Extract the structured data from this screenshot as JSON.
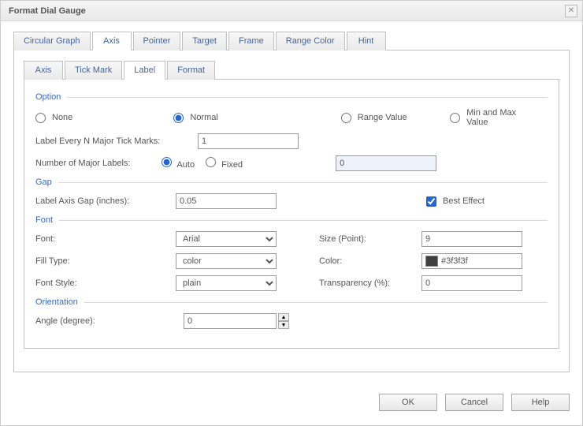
{
  "dialog": {
    "title": "Format Dial Gauge"
  },
  "outerTabs": [
    "Circular Graph",
    "Axis",
    "Pointer",
    "Target",
    "Frame",
    "Range Color",
    "Hint"
  ],
  "outerActive": 1,
  "innerTabs": [
    "Axis",
    "Tick Mark",
    "Label",
    "Format"
  ],
  "innerActive": 2,
  "sections": {
    "option": "Option",
    "gap": "Gap",
    "font": "Font",
    "orientation": "Orientation"
  },
  "option": {
    "radios": {
      "none": "None",
      "normal": "Normal",
      "rangeValue": "Range Value",
      "minmax": "Min and Max Value"
    },
    "selected": "normal",
    "labelEveryN_label": "Label Every N Major Tick Marks:",
    "labelEveryN_value": "1",
    "numMajorLabels_label": "Number of Major Labels:",
    "autoLabel": "Auto",
    "fixedLabel": "Fixed",
    "numMajorSelected": "auto",
    "fixedValue": "0"
  },
  "gap": {
    "labelAxisGap_label": "Label Axis Gap (inches):",
    "labelAxisGap_value": "0.05",
    "bestEffect_label": "Best Effect",
    "bestEffect_checked": true
  },
  "font": {
    "font_label": "Font:",
    "font_value": "Arial",
    "size_label": "Size (Point):",
    "size_value": "9",
    "filltype_label": "Fill Type:",
    "filltype_value": "color",
    "color_label": "Color:",
    "color_value": "#3f3f3f",
    "fontstyle_label": "Font Style:",
    "fontstyle_value": "plain",
    "transparency_label": "Transparency (%):",
    "transparency_value": "0"
  },
  "orientation": {
    "angle_label": "Angle (degree):",
    "angle_value": "0"
  },
  "footer": {
    "ok": "OK",
    "cancel": "Cancel",
    "help": "Help"
  }
}
